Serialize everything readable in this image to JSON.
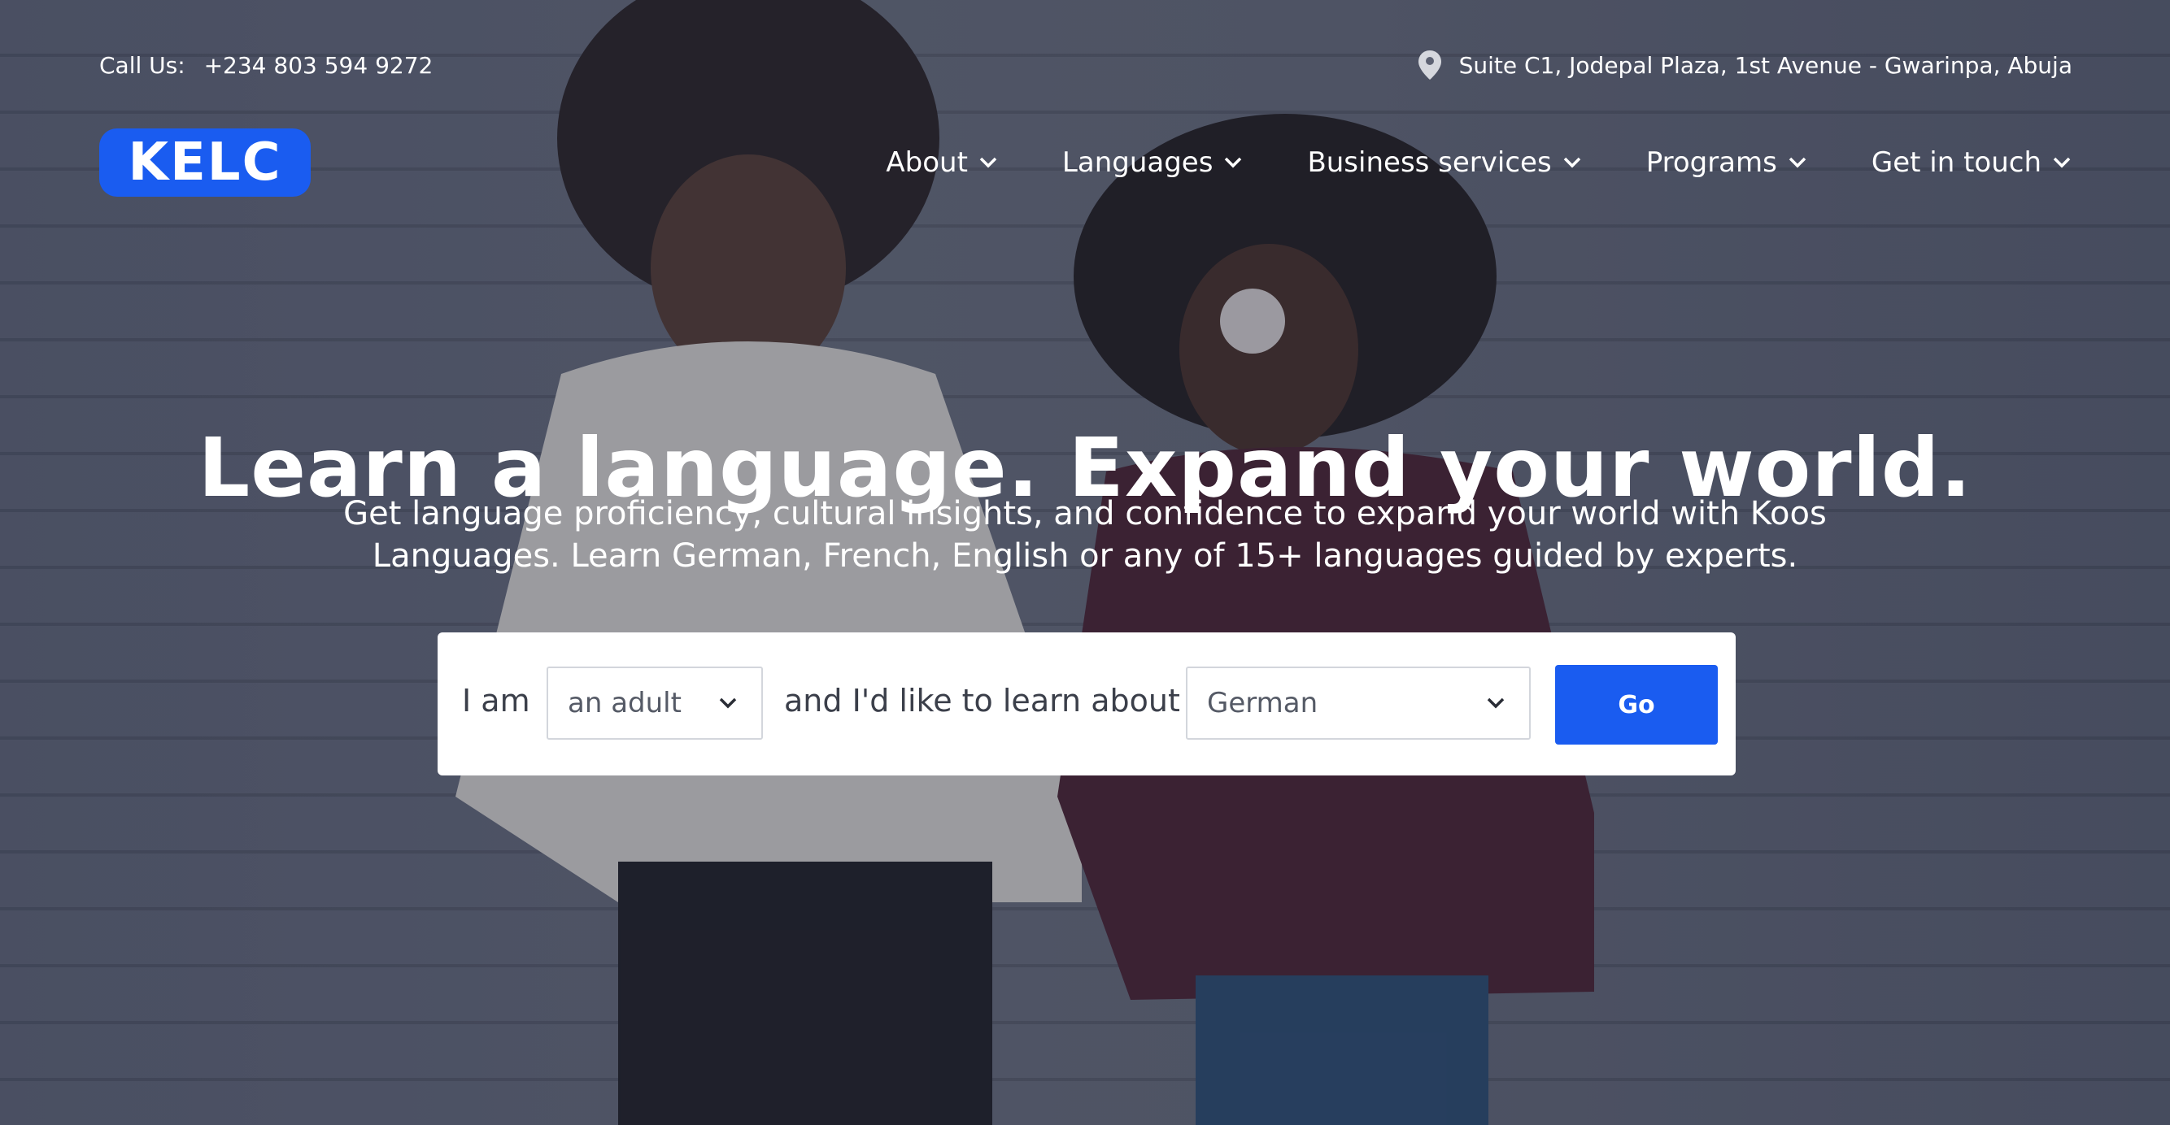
{
  "topbar": {
    "call_label": "Call Us:",
    "phone": "+234 803 594 9272",
    "address": "Suite C1, Jodepal Plaza, 1st Avenue - Gwarinpa, Abuja"
  },
  "brand": {
    "logo_text": "KELC",
    "color": "#1a5cf0"
  },
  "nav": {
    "items": [
      {
        "label": "About"
      },
      {
        "label": "Languages"
      },
      {
        "label": "Business services"
      },
      {
        "label": "Programs"
      },
      {
        "label": "Get in touch"
      }
    ]
  },
  "hero": {
    "headline": "Learn a language. Expand your world.",
    "subtext_line1": "Get language proficiency, cultural insights, and confidence to expand your world with Koos",
    "subtext_line2": "Languages. Learn German, French, English or any of 15+ languages guided by experts."
  },
  "finder": {
    "prefix": "I am",
    "audience_value": "an adult",
    "middle": "and I'd like to learn about",
    "language_value": "German",
    "go_label": "Go"
  },
  "icons": {
    "location": "map-pin-icon",
    "dropdown": "chevron-down-icon"
  }
}
